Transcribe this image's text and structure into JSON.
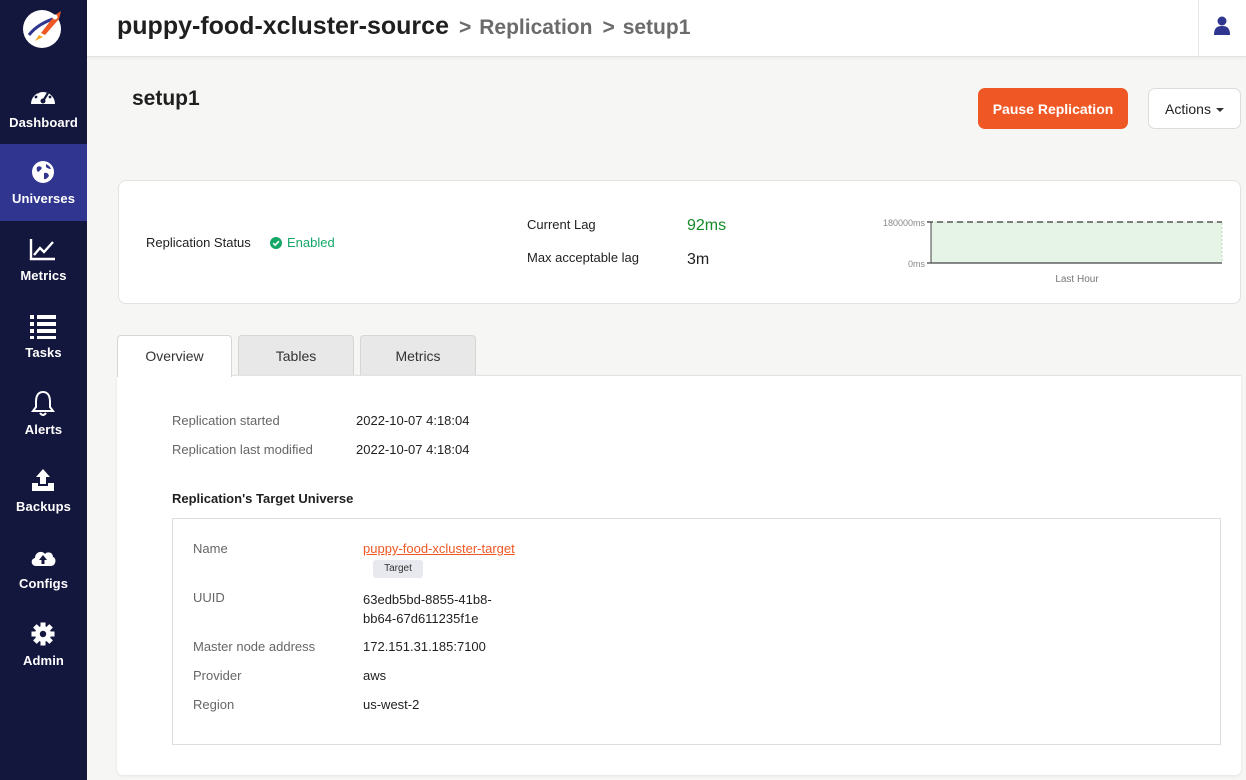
{
  "sidebar": {
    "items": [
      {
        "label": "Dashboard",
        "icon": "dashboard-icon",
        "active": false
      },
      {
        "label": "Universes",
        "icon": "globe-icon",
        "active": true
      },
      {
        "label": "Metrics",
        "icon": "line-chart-icon",
        "active": false
      },
      {
        "label": "Tasks",
        "icon": "list-icon",
        "active": false
      },
      {
        "label": "Alerts",
        "icon": "bell-icon",
        "active": false
      },
      {
        "label": "Backups",
        "icon": "upload-icon",
        "active": false
      },
      {
        "label": "Configs",
        "icon": "cloud-upload-icon",
        "active": false
      },
      {
        "label": "Admin",
        "icon": "gear-icon",
        "active": false
      }
    ]
  },
  "header": {
    "universe": "puppy-food-xcluster-source",
    "section": "Replication",
    "item": "setup1"
  },
  "page": {
    "title": "setup1",
    "pause_button": "Pause Replication",
    "actions_button": "Actions"
  },
  "status": {
    "status_label": "Replication Status",
    "status_value": "Enabled",
    "current_lag_label": "Current Lag",
    "current_lag_value": "92ms",
    "max_lag_label": "Max acceptable lag",
    "max_lag_value": "3m"
  },
  "chart_data": {
    "type": "area",
    "y_ticks": [
      "180000ms",
      "0ms"
    ],
    "x_label": "Last Hour",
    "threshold": "180000ms",
    "ylim": [
      0,
      180000
    ],
    "series": [
      {
        "values": [
          180000,
          180000
        ]
      }
    ]
  },
  "tabs": [
    {
      "label": "Overview",
      "active": true
    },
    {
      "label": "Tables",
      "active": false
    },
    {
      "label": "Metrics",
      "active": false
    }
  ],
  "overview": {
    "started_label": "Replication started",
    "started_value": "2022-10-07 4:18:04",
    "modified_label": "Replication last modified",
    "modified_value": "2022-10-07 4:18:04",
    "target_section_title": "Replication's Target Universe",
    "target": {
      "name_label": "Name",
      "name_value": "puppy-food-xcluster-target",
      "badge": "Target",
      "uuid_label": "UUID",
      "uuid_line1": "63edb5bd-8855-41b8-",
      "uuid_line2": "bb64-67d611235f1e",
      "master_label": "Master node address",
      "master_value": "172.151.31.185:7100",
      "provider_label": "Provider",
      "provider_value": "aws",
      "region_label": "Region",
      "region_value": "us-west-2"
    }
  },
  "colors": {
    "sidebar_bg": "#14173d",
    "sidebar_active": "#30368f",
    "accent_orange": "#ef5824",
    "status_green": "#13a866",
    "lag_green": "#168a28"
  }
}
